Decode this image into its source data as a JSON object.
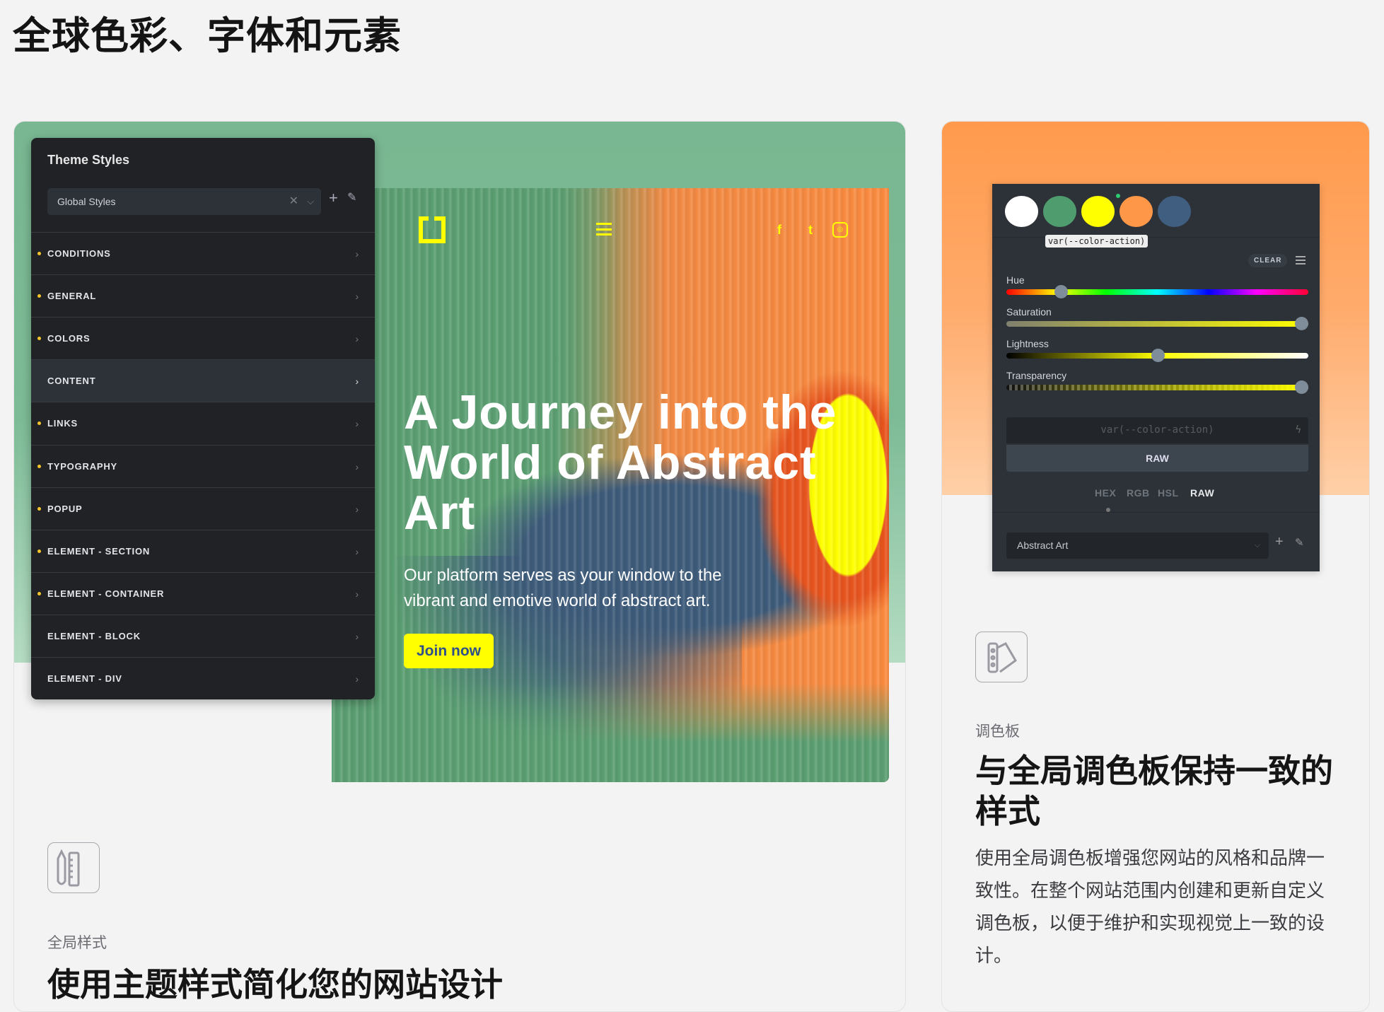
{
  "page_title": "全球色彩、字体和元素",
  "theme_panel": {
    "title": "Theme Styles",
    "select_value": "Global Styles",
    "rows": [
      {
        "label": "CONDITIONS",
        "modified": true
      },
      {
        "label": "GENERAL",
        "modified": true
      },
      {
        "label": "COLORS",
        "modified": true
      },
      {
        "label": "CONTENT",
        "modified": false,
        "active": true
      },
      {
        "label": "LINKS",
        "modified": true
      },
      {
        "label": "TYPOGRAPHY",
        "modified": true
      },
      {
        "label": "POPUP",
        "modified": true
      },
      {
        "label": "ELEMENT - SECTION",
        "modified": true
      },
      {
        "label": "ELEMENT - CONTAINER",
        "modified": true
      },
      {
        "label": "ELEMENT - BLOCK",
        "modified": false
      },
      {
        "label": "ELEMENT - DIV",
        "modified": false
      }
    ]
  },
  "hero": {
    "heading": "A Journey into the World of Abstract Art",
    "subtitle": "Our platform serves as your window to the vibrant and emotive world of abstract art.",
    "button": "Join now",
    "social_icons": [
      "facebook-icon",
      "twitter-icon",
      "instagram-icon"
    ]
  },
  "color_picker": {
    "swatches": [
      "#ffffff",
      "#4f9d6e",
      "#ffff00",
      "#ff9748",
      "#3f5e80"
    ],
    "selected_swatch": 2,
    "tooltip": "var(--color-action)",
    "clear": "CLEAR",
    "sliders": [
      {
        "label": "Hue",
        "value": 0.18
      },
      {
        "label": "Saturation",
        "value": 1.0
      },
      {
        "label": "Lightness",
        "value": 0.5
      },
      {
        "label": "Transparency",
        "value": 1.0
      }
    ],
    "input_placeholder": "var(--color-action)",
    "raw_button": "RAW",
    "formats": [
      "HEX",
      "RGB",
      "HSL",
      "RAW"
    ],
    "active_format": "RAW",
    "palette_select": "Abstract Art"
  },
  "right_card": {
    "eyebrow": "调色板",
    "heading": "与全局调色板保持一致的样式",
    "paragraph": "使用全局调色板增强您网站的风格和品牌一致性。在整个网站范围内创建和更新自定义调色板，以便于维护和实现视觉上一致的设计。"
  },
  "left_card": {
    "eyebrow": "全局样式",
    "heading": "使用主题样式简化您的网站设计"
  }
}
